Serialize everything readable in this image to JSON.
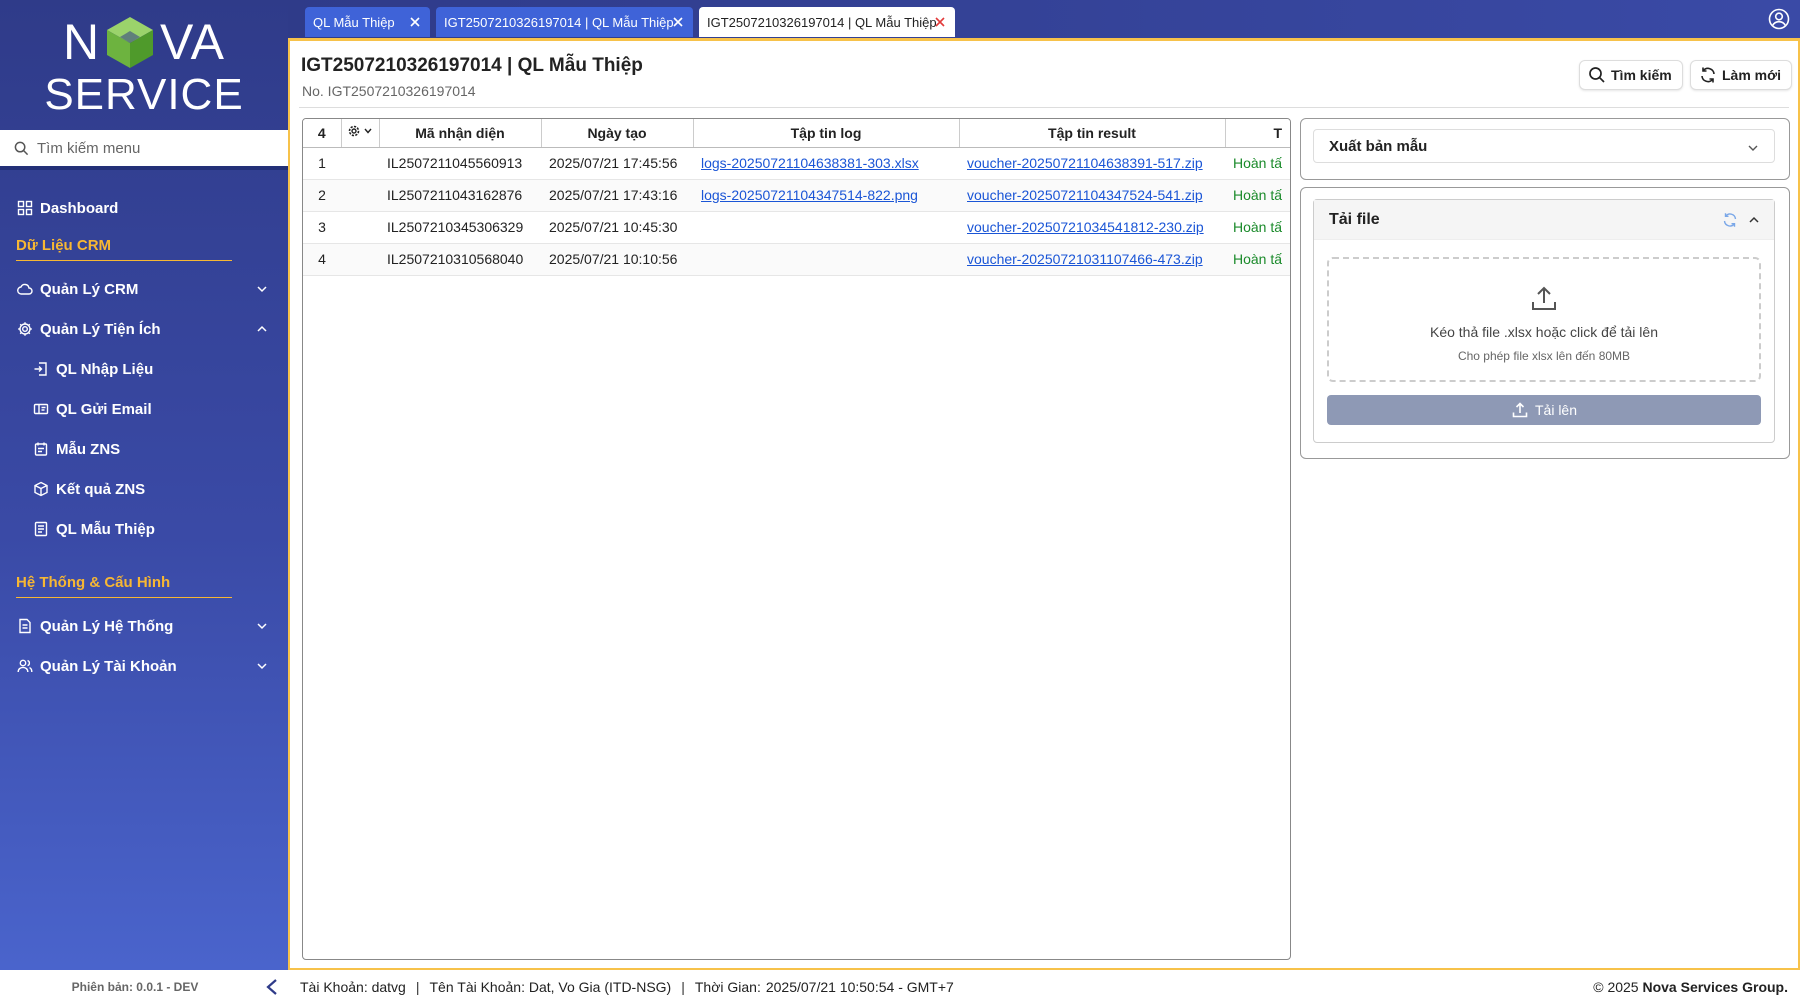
{
  "sidebar": {
    "logo": {
      "line1_left": "N",
      "line1_right": "VA",
      "line2": "SERVICE"
    },
    "search_placeholder": "Tìm kiếm menu",
    "items": [
      {
        "label": "Dashboard"
      },
      {
        "label": "Quản Lý CRM"
      },
      {
        "label": "Quản Lý Tiện Ích"
      },
      {
        "label": "QL Nhập Liệu"
      },
      {
        "label": "QL Gửi Email"
      },
      {
        "label": "Mẫu ZNS"
      },
      {
        "label": "Kết quả ZNS"
      },
      {
        "label": "QL Mẫu Thiệp"
      },
      {
        "label": "Quản Lý Hệ Thống"
      },
      {
        "label": "Quản Lý Tài Khoản"
      }
    ],
    "sections": [
      "Dữ Liệu CRM",
      "Hệ Thống & Cấu Hình"
    ],
    "version": "Phiên bản: 0.0.1 - DEV"
  },
  "tabs": [
    {
      "label": "QL Mẫu Thiệp"
    },
    {
      "label": "IGT2507210326197014 | QL Mẫu Thiệp"
    },
    {
      "label": "IGT2507210326197014 | QL Mẫu Thiệp"
    }
  ],
  "header": {
    "title": "IGT2507210326197014 | QL Mẫu Thiệp",
    "number": "No. IGT2507210326197014",
    "search_label": "Tìm kiếm",
    "refresh_label": "Làm mới"
  },
  "grid": {
    "count": "4",
    "columns": [
      "Mã nhận diện",
      "Ngày tạo",
      "Tập tin log",
      "Tập tin result",
      "T"
    ],
    "rows": [
      {
        "idx": "1",
        "code": "IL2507211045560913",
        "date": "2025/07/21 17:45:56",
        "log": "logs-20250721104638381-303.xlsx",
        "result": "voucher-20250721104638391-517.zip",
        "status": "Hoàn tấ"
      },
      {
        "idx": "2",
        "code": "IL2507211043162876",
        "date": "2025/07/21 17:43:16",
        "log": "logs-20250721104347514-822.png",
        "result": "voucher-20250721104347524-541.zip",
        "status": "Hoàn tấ"
      },
      {
        "idx": "3",
        "code": "IL2507210345306329",
        "date": "2025/07/21 10:45:30",
        "log": "",
        "result": "voucher-20250721034541812-230.zip",
        "status": "Hoàn tấ"
      },
      {
        "idx": "4",
        "code": "IL2507210310568040",
        "date": "2025/07/21 10:10:56",
        "log": "",
        "result": "voucher-20250721031107466-473.zip",
        "status": "Hoàn tấ"
      }
    ]
  },
  "right": {
    "export_select": "Xuất bản mẫu",
    "upload": {
      "title": "Tải file",
      "drop_text": "Kéo thả file .xlsx hoặc click để tải lên",
      "drop_sub": "Cho phép file xlsx lên đến 80MB",
      "button": "Tải lên"
    }
  },
  "footer": {
    "account": "Tài Khoản: datvg",
    "account_name": "Tên Tài Khoản: Dat, Vo Gia (ITD-NSG)",
    "time_label": "Thời Gian:",
    "time_value": "2025/07/21 10:50:54 - GMT+7",
    "copyright_prefix": "© 2025",
    "copyright_org": "Nova Services Group."
  },
  "colors": {
    "sidebar": "#2f3b89",
    "accent": "#f7b733",
    "link": "#1a55d6",
    "status": "#1a8a2a",
    "tab": "#3f63d8"
  }
}
